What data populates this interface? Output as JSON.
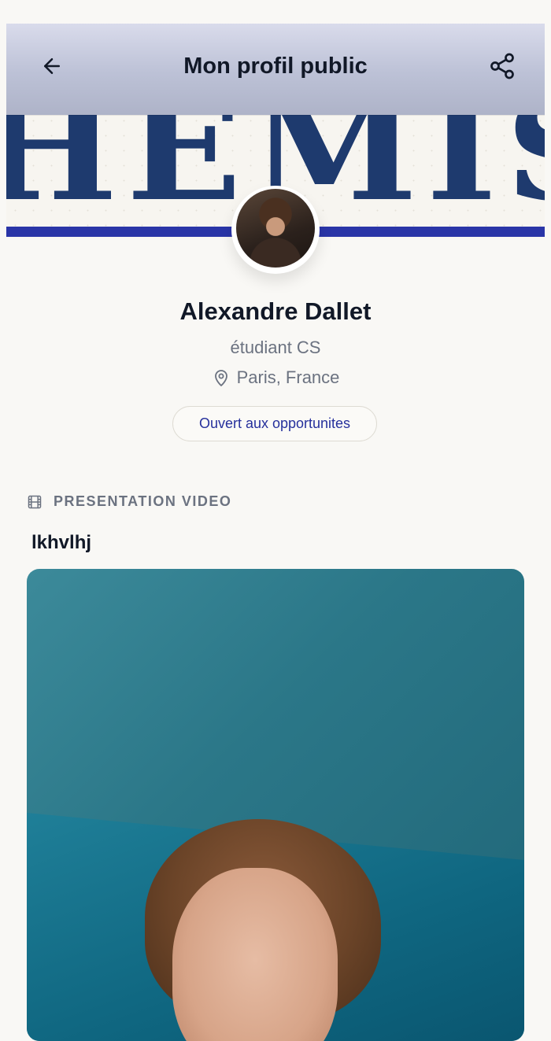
{
  "topbar": {
    "title": "Mon profil public",
    "back_icon": "arrow-left-icon",
    "share_icon": "share-icon"
  },
  "cover": {
    "word": "HEMIS"
  },
  "profile": {
    "name": "Alexandre Dallet",
    "role": "étudiant CS",
    "location": "Paris, France",
    "location_icon": "map-pin-icon",
    "badge": "Ouvert aux opportunites"
  },
  "section": {
    "icon": "film-icon",
    "heading": "PRESENTATION VIDEO",
    "video_title": "lkhvlhj"
  },
  "colors": {
    "accent": "#26309c",
    "cover_rule": "#2a35a7",
    "cover_text": "#1e3a6e",
    "muted_text": "#6b7280"
  }
}
